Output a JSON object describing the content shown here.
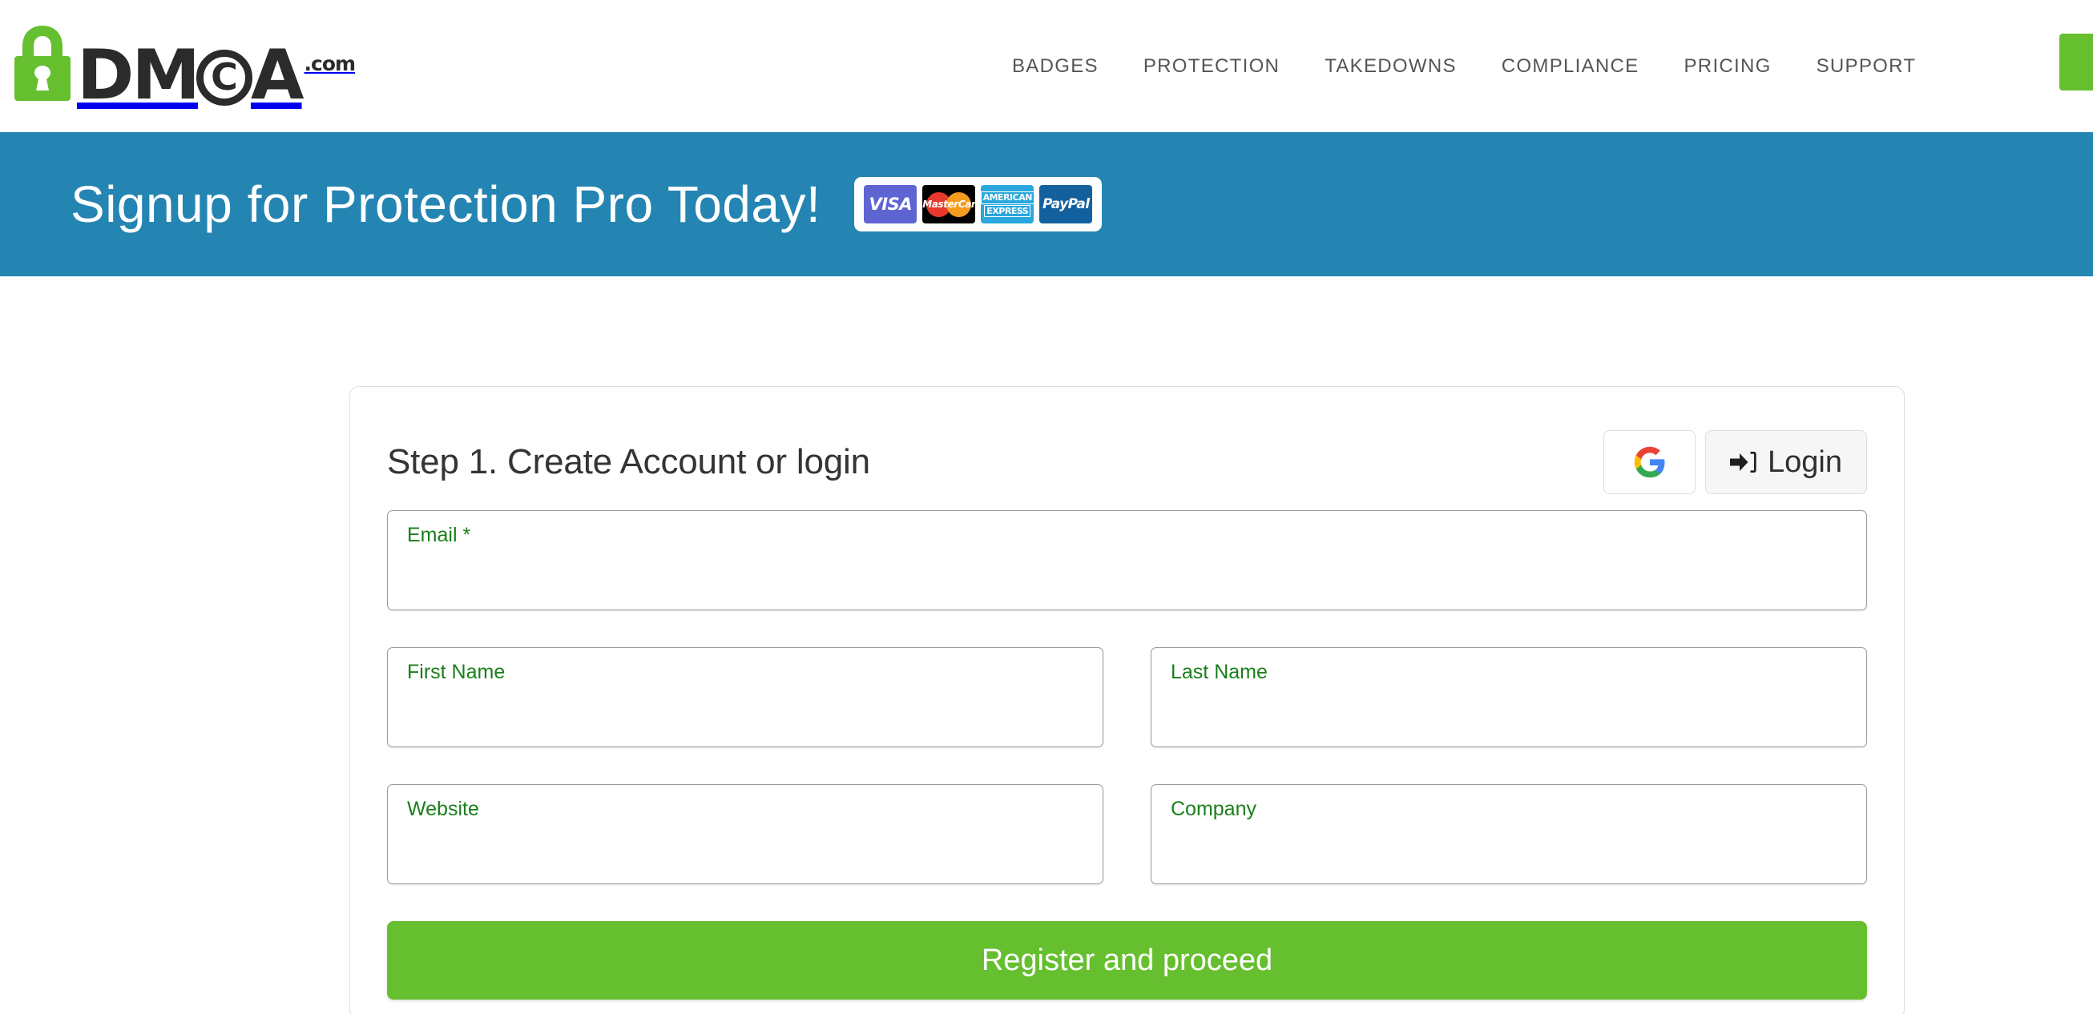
{
  "header": {
    "brand": {
      "letters_a": "DM",
      "copyright_mark": "C",
      "letters_b": "A",
      "tld": ".com",
      "alt": "DMCA.com"
    },
    "nav": [
      {
        "label": "BADGES"
      },
      {
        "label": "PROTECTION"
      },
      {
        "label": "TAKEDOWNS"
      },
      {
        "label": "COMPLIANCE"
      },
      {
        "label": "PRICING"
      },
      {
        "label": "SUPPORT"
      }
    ],
    "cta_label": ""
  },
  "banner": {
    "title": "Signup for Protection Pro Today!",
    "payments": [
      {
        "name": "visa",
        "label": "VISA"
      },
      {
        "name": "mastercard",
        "label": "MasterCard"
      },
      {
        "name": "american-express",
        "label_line1": "AMERICAN",
        "label_line2": "EXPRESS"
      },
      {
        "name": "paypal",
        "label": "PayPal"
      }
    ]
  },
  "signup": {
    "step_title": "Step 1. Create Account or login",
    "google_button": {
      "icon": "google-g-icon",
      "label": ""
    },
    "login_button": {
      "icon": "sign-in-icon",
      "label": "Login"
    },
    "fields": {
      "email": {
        "label": "Email *",
        "value": "",
        "placeholder": ""
      },
      "first_name": {
        "label": "First Name",
        "value": "",
        "placeholder": ""
      },
      "last_name": {
        "label": "Last Name",
        "value": "",
        "placeholder": ""
      },
      "website": {
        "label": "Website",
        "value": "",
        "placeholder": ""
      },
      "company": {
        "label": "Company",
        "value": "",
        "placeholder": ""
      }
    },
    "submit_label": "Register and proceed"
  },
  "colors": {
    "brand_green": "#66bf2f",
    "banner_blue": "#2585b2",
    "label_green": "#1a7e1a",
    "logo_dark": "#2b2b2b"
  }
}
